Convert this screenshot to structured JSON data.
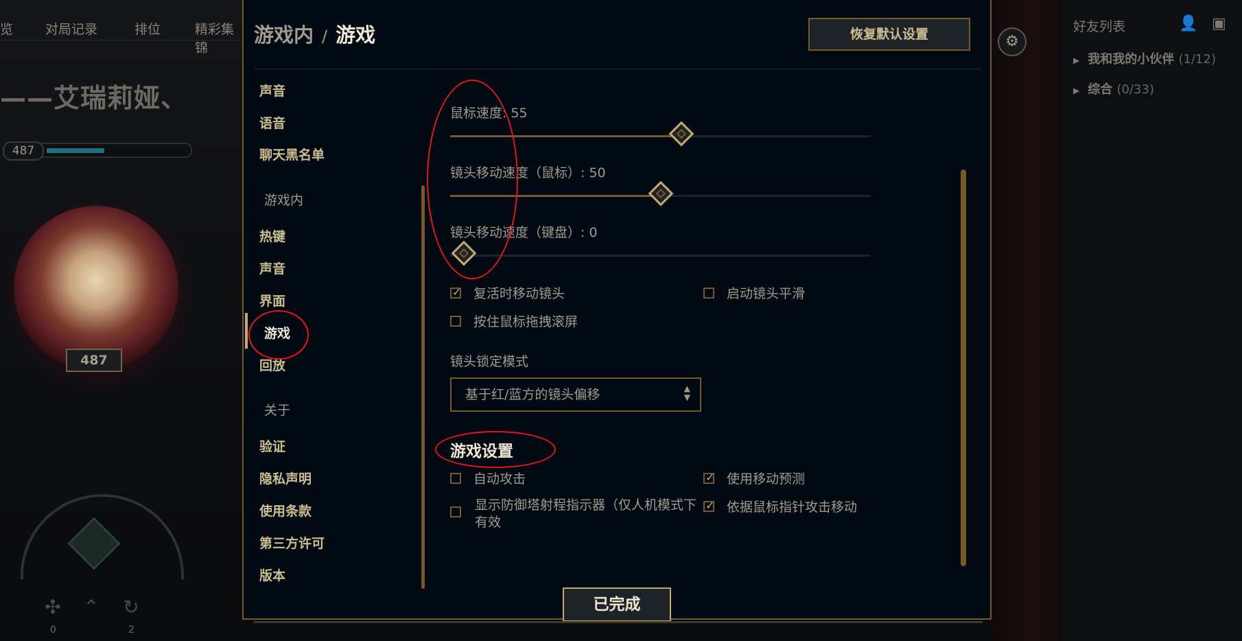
{
  "background": {
    "top_nav": [
      "览",
      "对局记录",
      "排位",
      "精彩集锦"
    ],
    "summoner_name": "——艾瑞莉娅、",
    "level": "487",
    "emblem_level": "487",
    "bottom_counts": [
      "0",
      "2"
    ],
    "friends": {
      "title": "好友列表",
      "groups": [
        {
          "name": "我和我的小伙伴",
          "count": "(1/12)"
        },
        {
          "name": "综合",
          "count": "(0/33)"
        }
      ]
    }
  },
  "modal": {
    "breadcrumb_parent": "游戏内",
    "breadcrumb_sep": "/",
    "breadcrumb_current": "游戏",
    "reset_label": "恢复默认设置",
    "done_label": "已完成",
    "nav": {
      "client_items": [
        "声音",
        "语音",
        "聊天黑名单"
      ],
      "ingame_section": "游戏内",
      "ingame_items": [
        "热键",
        "声音",
        "界面",
        "游戏",
        "回放"
      ],
      "about_section": "关于",
      "about_items": [
        "验证",
        "隐私声明",
        "使用条款",
        "第三方许可",
        "版本"
      ]
    },
    "sliders": [
      {
        "label": "鼠标速度: 55",
        "value": 55,
        "max": 100
      },
      {
        "label": "镜头移动速度（鼠标）: 50",
        "value": 50,
        "max": 100
      },
      {
        "label": "镜头移动速度（键盘）: 0",
        "value": 0,
        "max": 100
      }
    ],
    "camera_checkboxes": [
      {
        "label": "复活时移动镜头",
        "checked": true
      },
      {
        "label": "启动镜头平滑",
        "checked": false
      },
      {
        "label": "按住鼠标拖拽滚屏",
        "checked": false
      }
    ],
    "lock_mode": {
      "label": "镜头锁定模式",
      "selected": "基于红/蓝方的镜头偏移"
    },
    "game_settings": {
      "heading": "游戏设置",
      "checkboxes": [
        {
          "label": "自动攻击",
          "checked": false
        },
        {
          "label": "使用移动预测",
          "checked": true
        },
        {
          "label": "显示防御塔射程指示器（仅人机模式下有效",
          "checked": false
        },
        {
          "label": "依据鼠标指针攻击移动",
          "checked": true
        }
      ]
    }
  },
  "colors": {
    "gold": "#c8aa6e",
    "gold_dark": "#785a28",
    "annotation_red": "#e8141a",
    "modal_bg": "#010a13"
  },
  "icons": [
    "add-friend-icon",
    "add-folder-icon",
    "gear-icon",
    "chevron-right-icon",
    "checkmark-icon",
    "updown-arrows-icon"
  ]
}
